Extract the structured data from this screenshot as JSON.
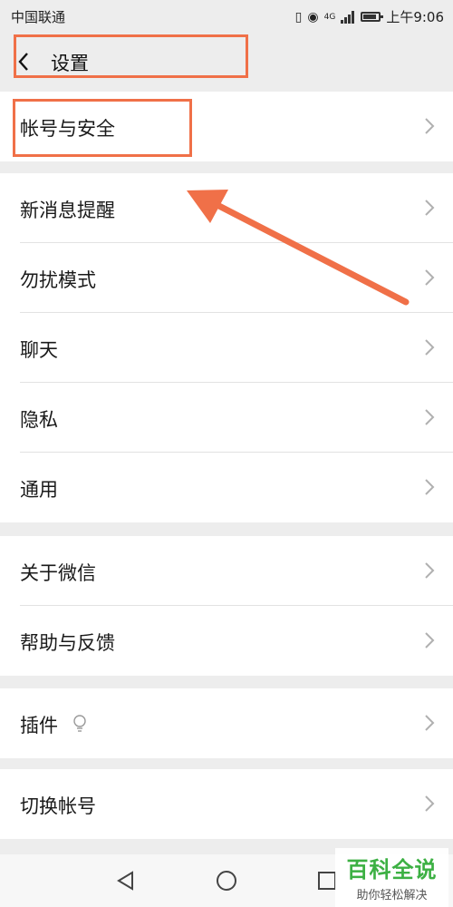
{
  "status": {
    "carrier": "中国联通",
    "network": "4G",
    "time": "上午9:06"
  },
  "header": {
    "title": "设置"
  },
  "groups": [
    {
      "items": [
        {
          "label": "帐号与安全"
        }
      ]
    },
    {
      "items": [
        {
          "label": "新消息提醒"
        },
        {
          "label": "勿扰模式"
        },
        {
          "label": "聊天"
        },
        {
          "label": "隐私"
        },
        {
          "label": "通用"
        }
      ]
    },
    {
      "items": [
        {
          "label": "关于微信"
        },
        {
          "label": "帮助与反馈"
        }
      ]
    },
    {
      "items": [
        {
          "label": "插件"
        }
      ]
    },
    {
      "items": [
        {
          "label": "切换帐号"
        }
      ]
    }
  ],
  "watermark": {
    "main": "百科全说",
    "sub": "助你轻松解决"
  },
  "colors": {
    "annotation": "#f07048",
    "background": "#ededed",
    "watermark": "#3cb043"
  }
}
